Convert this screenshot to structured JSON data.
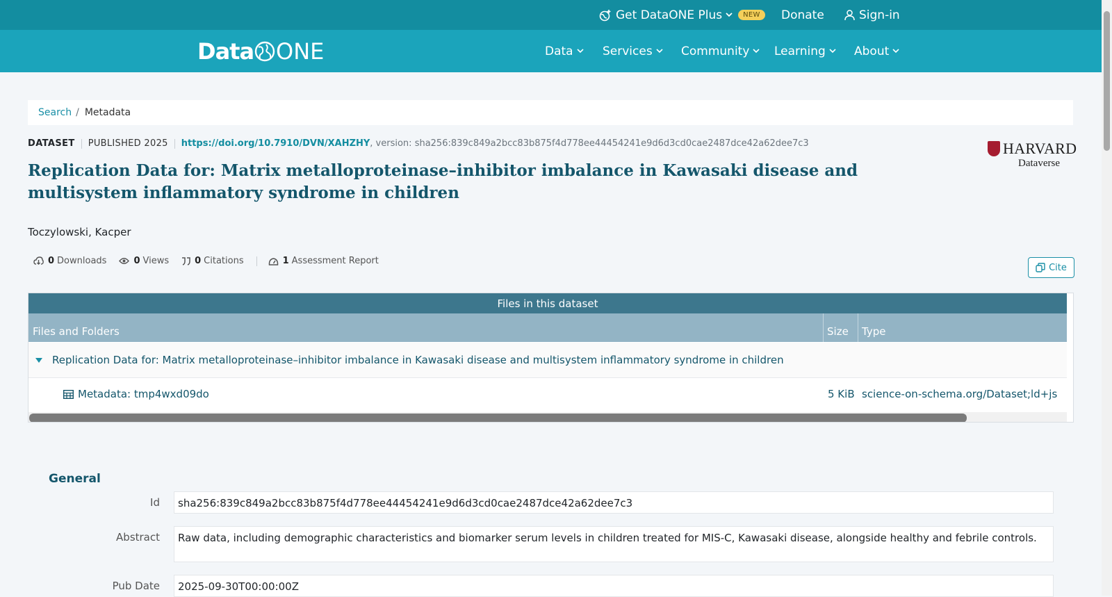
{
  "topbar": {
    "plus_label": "Get DataONE Plus",
    "new_badge": "NEW",
    "donate_label": "Donate",
    "signin_label": "Sign-in"
  },
  "brand": {
    "logo_data": "Data",
    "logo_one": "ONE"
  },
  "nav": {
    "items": [
      {
        "label": "Data"
      },
      {
        "label": "Services"
      },
      {
        "label": "Community"
      },
      {
        "label": "Learning"
      },
      {
        "label": "About"
      }
    ]
  },
  "breadcrumb": {
    "search": "Search",
    "separator": "/",
    "current": "Metadata"
  },
  "dataset": {
    "type_label": "DATASET",
    "published": "PUBLISHED 2025",
    "doi": "https://doi.org/10.7910/DVN/XAHZHY",
    "version": ", version: sha256:839c849a2bcc83b875f4d778ee44454241e9d6d3cd0cae2487dce42a62dee7c3",
    "title": "Replication Data for: Matrix metalloproteinase–inhibitor imbalance in Kawasaki disease and multisystem inflammatory syndrome in children",
    "author": "Toczylowski, Kacper",
    "repository_name": "HARVARD",
    "repository_sub": "Dataverse"
  },
  "stats": {
    "downloads_count": "0",
    "downloads_label": "Downloads",
    "views_count": "0",
    "views_label": "Views",
    "citations_count": "0",
    "citations_label": "Citations",
    "assessment_count": "1",
    "assessment_label": "Assessment Report",
    "cite_label": "Cite"
  },
  "files": {
    "caption": "Files in this dataset",
    "columns": [
      "Files and Folders",
      "Size",
      "Type"
    ],
    "folder_name": "Replication Data for: Matrix metalloproteinase–inhibitor imbalance in Kawasaki disease and multisystem inflammatory syndrome in children",
    "rows": [
      {
        "name": "Metadata: tmp4wxd09do",
        "size": "5 KiB",
        "type": "science-on-schema.org/Dataset;ld+js"
      }
    ]
  },
  "general": {
    "heading": "General",
    "fields": [
      {
        "label": "Id",
        "value": "sha256:839c849a2bcc83b875f4d778ee44454241e9d6d3cd0cae2487dce42a62dee7c3"
      },
      {
        "label": "Abstract",
        "value": "Raw data, including demographic characteristics and biomarker serum levels in children treated for MIS-C, Kawasaki disease, alongside healthy and febrile controls."
      },
      {
        "label": "Pub Date",
        "value": "2025-09-30T00:00:00Z"
      }
    ]
  },
  "colors": {
    "topbar": "#138da0",
    "nav": "#1ba4bb",
    "accent": "#1a8fa6",
    "title": "#14566b",
    "table_caption": "#3d778d",
    "table_header": "#93b4c5",
    "badge": "#f4cf5a"
  }
}
